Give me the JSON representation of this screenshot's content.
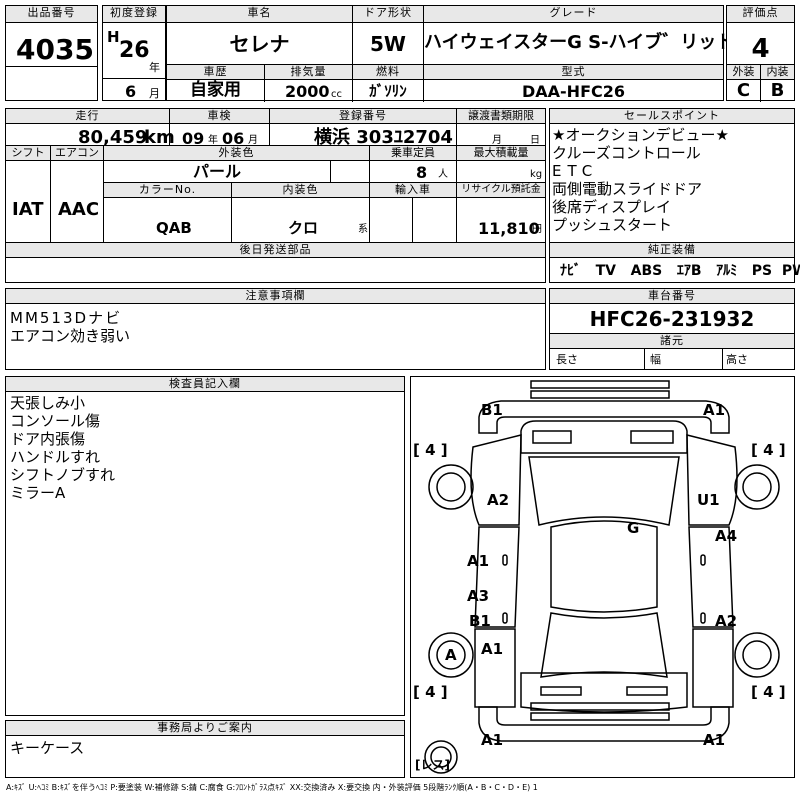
{
  "lot": {
    "label": "出品番号",
    "value": "4035"
  },
  "first_reg": {
    "label": "初度登録",
    "era": "H",
    "year": "26",
    "year_unit": "年",
    "month": "6",
    "month_unit": "月"
  },
  "car_name": {
    "label": "車名",
    "value": "セレナ"
  },
  "door": {
    "label": "ドア形状",
    "value": "5W"
  },
  "grade": {
    "label": "グレード",
    "value": "ハイウェイスターG S-ハイブ゛リット゛"
  },
  "score": {
    "label": "評価点",
    "value": "4",
    "ext_label": "外装",
    "int_label": "内装",
    "ext": "C",
    "int": "B"
  },
  "history": {
    "label": "車歴",
    "value": "自家用"
  },
  "displacement": {
    "label": "排気量",
    "value": "2000",
    "unit": "cc"
  },
  "fuel": {
    "label": "燃料",
    "value": "ｶﾞｿﾘﾝ"
  },
  "model": {
    "label": "型式",
    "value": "DAA-HFC26"
  },
  "mileage": {
    "label": "走行",
    "value": "80,459",
    "unit": "km"
  },
  "inspection": {
    "label": "車検",
    "year": "09",
    "year_unit": "年",
    "month": "06",
    "month_unit": "月"
  },
  "registration": {
    "label": "登録番号",
    "value": "横浜 303ﾕ2704"
  },
  "transfer_deadline": {
    "label": "譲渡書類期限",
    "month_unit": "月",
    "day_unit": "日"
  },
  "shift": {
    "label": "シフト",
    "value": "IAT"
  },
  "aircon": {
    "label": "エアコン",
    "value": "AAC"
  },
  "exterior_color": {
    "label": "外装色",
    "value": "パール"
  },
  "capacity": {
    "label": "乗車定員",
    "value": "8",
    "unit": "人"
  },
  "max_load": {
    "label": "最大積載量",
    "unit": "kg"
  },
  "color_no": {
    "label": "カラーNo.",
    "value": "QAB"
  },
  "interior_color": {
    "label": "内装色",
    "value": "クロ",
    "unit": "系"
  },
  "import": {
    "label": "輸入車"
  },
  "recycle": {
    "label": "リサイクル預託金",
    "value": "11,810",
    "unit": "円"
  },
  "later_parts": {
    "label": "後日発送部品"
  },
  "sales_points": {
    "label": "セールスポイント",
    "items": [
      "★オークションデビュー★",
      "クルーズコントロール",
      "ETC",
      "両側電動スライドドア",
      "後席ディスプレイ",
      "プッシュスタート"
    ]
  },
  "equipment": {
    "label": "純正装備",
    "items": [
      "ﾅﾋﾞ",
      "TV",
      "ABS",
      "ｴｱB",
      "ｱﾙﾐ",
      "PS",
      "PW"
    ]
  },
  "notes": {
    "label": "注意事項欄",
    "items": [
      "MM513Dナビ",
      "エアコン効き弱い"
    ]
  },
  "chassis": {
    "label": "車台番号",
    "value": "HFC26-231932"
  },
  "specs": {
    "label": "諸元",
    "length": "長さ",
    "width": "幅",
    "height": "高さ"
  },
  "inspector": {
    "label": "検査員記入欄",
    "items": [
      "天張しみ小",
      "コンソール傷",
      "ドア内張傷",
      "ハンドルすれ",
      "シフトノブすれ",
      "ミラーA"
    ]
  },
  "office": {
    "label": "事務局よりご案内",
    "items": [
      "キーケース"
    ]
  },
  "diagram": {
    "marks": {
      "front_left": "B1",
      "front_right": "A1",
      "left_front_fender": "A2",
      "right_front_fender": "U1",
      "roof": "G",
      "left_front_door": "A1",
      "right_front_door": "A4",
      "left_slide_door_upper": "A3",
      "left_slide_door_lower": "B1",
      "right_slide_door": "A2",
      "left_rear_wheel": "A",
      "left_rear_quarter": "A1",
      "rear_left": "A1",
      "rear_right": "A1"
    },
    "tires": {
      "fl": "4",
      "fr": "4",
      "rl": "4",
      "rr": "4"
    },
    "spare": "レス"
  },
  "legend": "A:ｷｽﾞ U:ﾍｺﾐ B:ｷｽﾞを伴うﾍｺﾐ P:要塗装 W:補修跡 S:錆 C:腐食 G:ﾌﾛﾝﾄｶﾞﾗｽ点ｷｽﾞ XX:交換済み X:要交換 内・外装評価 5段階ﾗﾝｸ順(A・B・C・D・E) 1"
}
